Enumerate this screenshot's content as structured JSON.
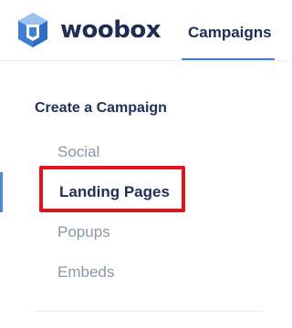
{
  "brand": {
    "name": "woobox",
    "logo_icon": "woobox-logo-icon",
    "colors": {
      "brand_dark": "#1e2d54",
      "logo_blue": "#3f7fd1",
      "logo_light": "#9cc3ef",
      "highlight_red": "#e4131b",
      "muted_text": "#8c96a6"
    }
  },
  "header": {
    "nav_tab_label": "Campaigns"
  },
  "sidebar": {
    "section_title": "Create a Campaign",
    "items": [
      {
        "label": "Social"
      },
      {
        "label": "Landing Pages",
        "selected": true
      },
      {
        "label": "Popups"
      },
      {
        "label": "Embeds"
      }
    ]
  }
}
